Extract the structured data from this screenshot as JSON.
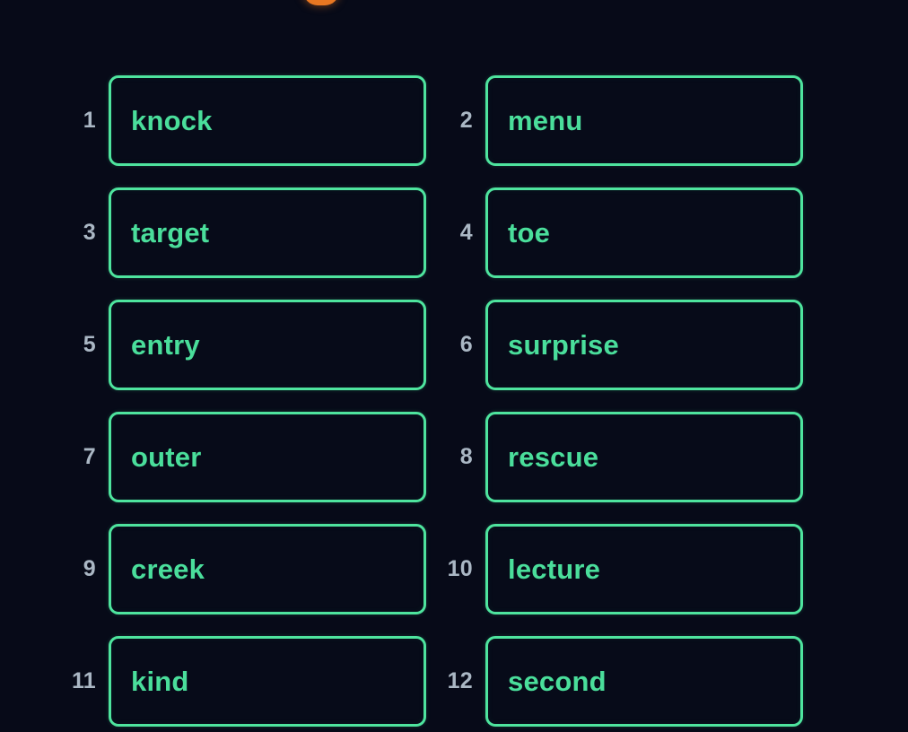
{
  "colors": {
    "background": "#070a18",
    "box_border": "#4ee49e",
    "word_text": "#4ade9b",
    "number_text": "#aab7c4",
    "accent_orange": "#e87722"
  },
  "top_badge": {
    "name": "clipped-orange-badge"
  },
  "word_list": {
    "items": [
      {
        "number": "1",
        "word": "knock"
      },
      {
        "number": "2",
        "word": "menu"
      },
      {
        "number": "3",
        "word": "target"
      },
      {
        "number": "4",
        "word": "toe"
      },
      {
        "number": "5",
        "word": "entry"
      },
      {
        "number": "6",
        "word": "surprise"
      },
      {
        "number": "7",
        "word": "outer"
      },
      {
        "number": "8",
        "word": "rescue"
      },
      {
        "number": "9",
        "word": "creek"
      },
      {
        "number": "10",
        "word": "lecture"
      },
      {
        "number": "11",
        "word": "kind"
      },
      {
        "number": "12",
        "word": "second"
      }
    ]
  }
}
